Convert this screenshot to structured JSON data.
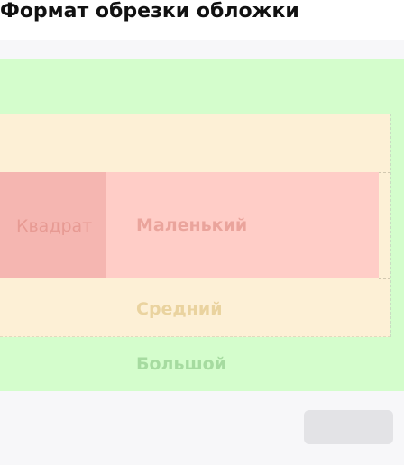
{
  "dialog": {
    "title": "Формат обрезки обложки"
  },
  "zones": {
    "square": {
      "label": "Квадрат",
      "color": "#f5b6b1"
    },
    "small": {
      "label": "Маленький",
      "color": "#ffcdc7"
    },
    "medium": {
      "label": "Средний",
      "color": "#fdf0d6"
    },
    "large": {
      "label": "Большой",
      "color": "#d4fdcc"
    }
  },
  "actions": {
    "confirm_label": ""
  }
}
